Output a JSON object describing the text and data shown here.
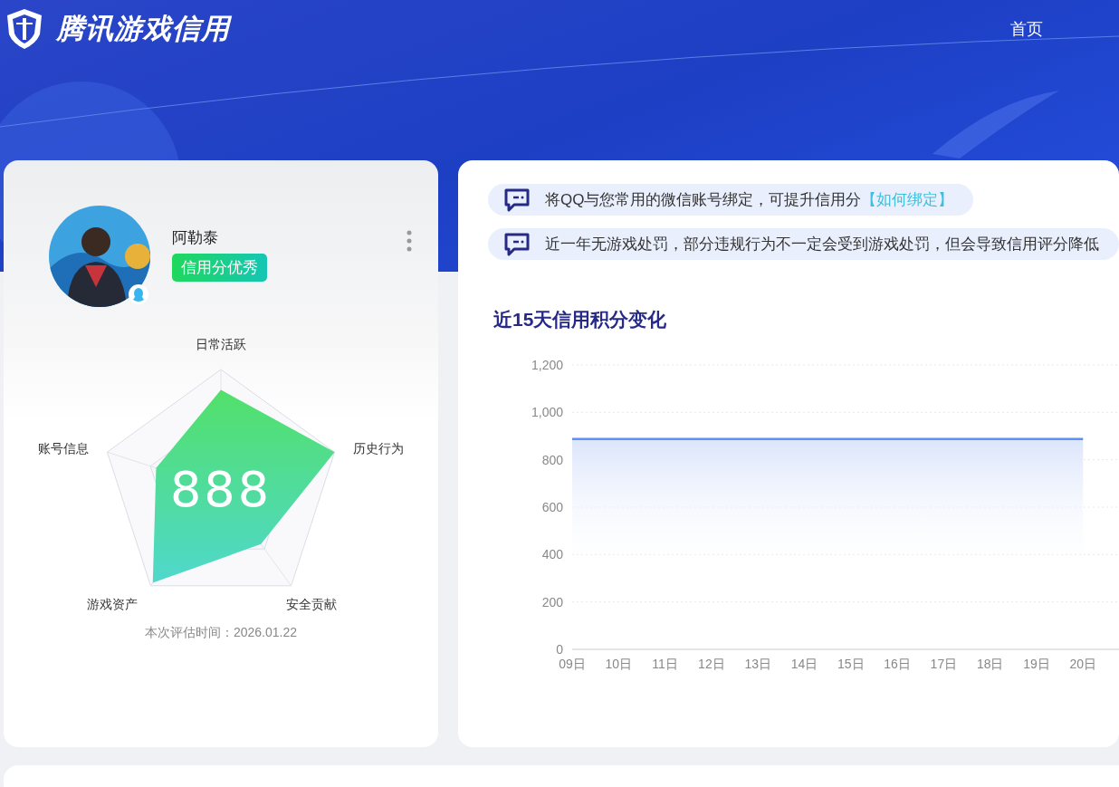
{
  "header": {
    "title": "腾讯游戏信用",
    "nav": [
      {
        "label": "首页"
      }
    ]
  },
  "profile": {
    "name": "阿勒泰",
    "badge": "信用分优秀",
    "radar": {
      "axes": [
        "日常活跃",
        "历史行为",
        "安全贡献",
        "游戏资产",
        "账号信息"
      ],
      "score": "888"
    },
    "evaluated": "本次评估时间：2026.01.22"
  },
  "notices": [
    {
      "text": "将QQ与您常用的微信账号绑定，可提升信用分",
      "link": "【如何绑定】"
    },
    {
      "text": "近一年无游戏处罚，部分违规行为不一定会受到游戏处罚，但会导致信用评分降低"
    }
  ],
  "chart": {
    "title": "近15天信用积分变化",
    "chart_data": {
      "type": "area",
      "categories": [
        "09日",
        "10日",
        "11日",
        "12日",
        "13日",
        "14日",
        "15日",
        "16日",
        "17日",
        "18日",
        "19日",
        "20日"
      ],
      "series": [
        {
          "color": "#5b8ff9",
          "values": [
            888,
            888,
            888,
            888,
            888,
            888,
            888,
            888,
            888,
            888,
            888,
            888
          ]
        }
      ],
      "grid": true,
      "ylim": [
        0,
        1200
      ],
      "yticks": [
        0,
        200,
        400,
        600,
        800,
        {
          "value": 1000,
          "label": "1,000"
        },
        {
          "value": 1200,
          "label": "1,200"
        }
      ]
    }
  }
}
